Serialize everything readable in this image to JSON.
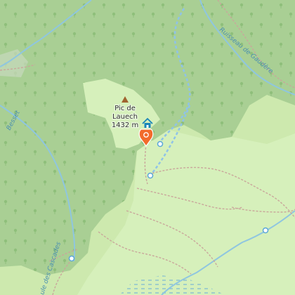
{
  "map": {
    "summit": {
      "name_line1": "Pic de",
      "name_line2": "Lauech",
      "elevation": "1432 m"
    },
    "stream_labels": {
      "upper_right": "Ruisseau de Gaudère",
      "left": "Besset",
      "lower_left": "ule des Cascades"
    },
    "icons": {
      "summit": "peak-triangle-icon",
      "shelter": "shelter-hut-icon",
      "marker": "location-pin-icon",
      "spring": "spring-icon"
    },
    "colors": {
      "forest": "#a9cf94",
      "meadow": "#cde9ae",
      "grass": "#d6f0bb",
      "water": "#8fc6e0",
      "path": "#c9a79b",
      "path_blue": "#8fc3e8",
      "marker": "#f26b2b",
      "shelter": "#1a85b8",
      "peak": "#a0632f"
    }
  }
}
